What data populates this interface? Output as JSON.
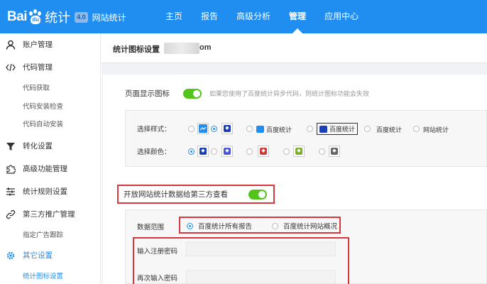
{
  "colors": {
    "brand": "#1f8ef0",
    "toggle_on": "#52c41a",
    "highlight_border": "#d9363e"
  },
  "brand": {
    "logo_left": "Bai",
    "logo_paw": "du",
    "logo_right": "统计",
    "badge": "4.0",
    "site": "网站统计"
  },
  "nav": [
    {
      "label": "主页"
    },
    {
      "label": "报告"
    },
    {
      "label": "高级分析"
    },
    {
      "label": "管理",
      "active": true
    },
    {
      "label": "应用中心"
    }
  ],
  "sidebar": {
    "items": [
      {
        "label": "账户管理",
        "icon": "user-icon"
      },
      {
        "label": "代码管理",
        "icon": "code-icon"
      },
      {
        "label": "转化设置",
        "icon": "funnel-icon"
      },
      {
        "label": "高级功能管理",
        "icon": "puzzle-icon"
      },
      {
        "label": "统计规则设置",
        "icon": "sliders-icon"
      },
      {
        "label": "第三方推广管理",
        "icon": "link-icon"
      },
      {
        "label": "其它设置",
        "icon": "gear-icon"
      }
    ],
    "code_subs": [
      "代码获取",
      "代码安装检查",
      "代码自动安装"
    ],
    "third_party_subs": [
      "指定广告跟踪"
    ],
    "other_subs": [
      "统计图标设置"
    ]
  },
  "main": {
    "title": "统计图标设置",
    "title_suffix": "om",
    "page_icon": {
      "label": "页面显示图标",
      "enabled": true,
      "hint": "如果您使用了百度统计异步代码，则统计图标功能会失效"
    },
    "style": {
      "label": "选择样式：",
      "options": [
        "",
        "",
        "百度统计",
        "百度统计",
        "百度统计",
        "网站统计"
      ]
    },
    "color": {
      "label": "选择颜色：",
      "swatches": [
        "#1c3fb3",
        "#4a56d6",
        "#d23b34",
        "#7fae2a",
        "#666666"
      ]
    },
    "share": {
      "label": "开放网站统计数据给第三方查看",
      "enabled": true
    },
    "data_range": {
      "label": "数据范围",
      "options": [
        "百度统计所有报告",
        "百度统计网站概况"
      ]
    },
    "password": {
      "label": "输入注册密码",
      "value": "",
      "confirm_label": "再次输入密码",
      "confirm_value": ""
    }
  }
}
